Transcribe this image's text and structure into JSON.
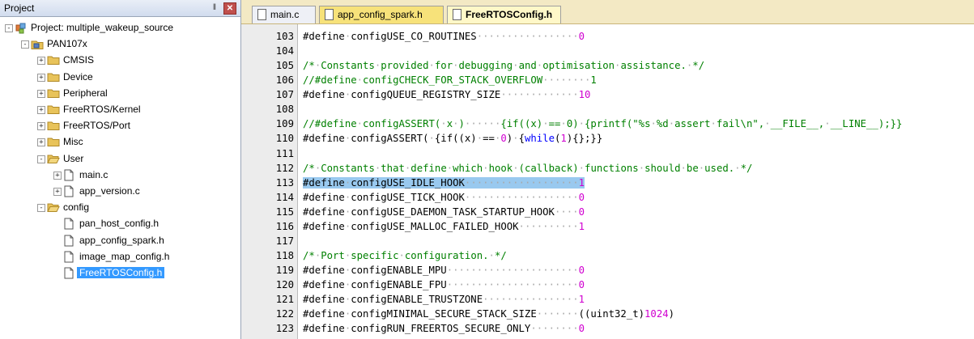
{
  "project_panel": {
    "title": "Project",
    "pin_icon": "pin-icon",
    "close_icon": "close-icon",
    "tree": [
      {
        "label": "Project: multiple_wakeup_source",
        "icon": "project-icon",
        "expander": "-",
        "level": 0
      },
      {
        "label": "PAN107x",
        "icon": "target-icon",
        "expander": "-",
        "level": 1
      },
      {
        "label": "CMSIS",
        "icon": "folder-icon",
        "expander": "+",
        "level": 2
      },
      {
        "label": "Device",
        "icon": "folder-icon",
        "expander": "+",
        "level": 2
      },
      {
        "label": "Peripheral",
        "icon": "folder-icon",
        "expander": "+",
        "level": 2
      },
      {
        "label": "FreeRTOS/Kernel",
        "icon": "folder-icon",
        "expander": "+",
        "level": 2
      },
      {
        "label": "FreeRTOS/Port",
        "icon": "folder-icon",
        "expander": "+",
        "level": 2
      },
      {
        "label": "Misc",
        "icon": "folder-icon",
        "expander": "+",
        "level": 2
      },
      {
        "label": "User",
        "icon": "folder-open-icon",
        "expander": "-",
        "level": 2
      },
      {
        "label": "main.c",
        "icon": "file-icon",
        "expander": "+",
        "level": 3
      },
      {
        "label": "app_version.c",
        "icon": "file-icon",
        "expander": "+",
        "level": 3
      },
      {
        "label": "config",
        "icon": "folder-open-icon",
        "expander": "-",
        "level": 2
      },
      {
        "label": "pan_host_config.h",
        "icon": "file-icon",
        "expander": "",
        "level": 3
      },
      {
        "label": "app_config_spark.h",
        "icon": "file-icon",
        "expander": "",
        "level": 3
      },
      {
        "label": "image_map_config.h",
        "icon": "file-icon",
        "expander": "",
        "level": 3
      },
      {
        "label": "FreeRTOSConfig.h",
        "icon": "file-icon",
        "expander": "",
        "level": 3,
        "selected": true
      }
    ]
  },
  "editor": {
    "tabs": [
      {
        "label": "main.c",
        "active": false
      },
      {
        "label": "app_config_spark.h",
        "active": false
      },
      {
        "label": "FreeRTOSConfig.h",
        "active": true
      }
    ],
    "lines": [
      {
        "n": "103",
        "text": "#define configUSE_CO_ROUTINES                 0"
      },
      {
        "n": "104",
        "text": ""
      },
      {
        "n": "105",
        "text": "/* Constants provided for debugging and optimisation assistance. */"
      },
      {
        "n": "106",
        "text": "//#define configCHECK_FOR_STACK_OVERFLOW        1"
      },
      {
        "n": "107",
        "text": "#define configQUEUE_REGISTRY_SIZE             10"
      },
      {
        "n": "108",
        "text": ""
      },
      {
        "n": "109",
        "text": "//#define configASSERT( x )      {if((x) == 0) {printf(\"%s %d assert fail\\n\", __FILE__, __LINE__);}}"
      },
      {
        "n": "110",
        "text": "#define configASSERT( x )       {if((x) == 0) {while(1){};}}"
      },
      {
        "n": "111",
        "text": ""
      },
      {
        "n": "112",
        "text": "/* Constants that define which hook (callback) functions should be used. */"
      },
      {
        "n": "113",
        "text": "#define configUSE_IDLE_HOOK                   1"
      },
      {
        "n": "114",
        "text": "#define configUSE_TICK_HOOK                   0"
      },
      {
        "n": "115",
        "text": "#define configUSE_DAEMON_TASK_STARTUP_HOOK    0"
      },
      {
        "n": "116",
        "text": "#define configUSE_MALLOC_FAILED_HOOK          1"
      },
      {
        "n": "117",
        "text": ""
      },
      {
        "n": "118",
        "text": "/* Port specific configuration. */"
      },
      {
        "n": "119",
        "text": "#define configENABLE_MPU                      0"
      },
      {
        "n": "120",
        "text": "#define configENABLE_FPU                      0"
      },
      {
        "n": "121",
        "text": "#define configENABLE_TRUSTZONE                1"
      },
      {
        "n": "122",
        "text": "#define configMINIMAL_SECURE_STACK_SIZE       ((uint32_t)1024)"
      },
      {
        "n": "123",
        "text": "#define configRUN_FREERTOS_SECURE_ONLY        0"
      }
    ],
    "highlighted_line": "113",
    "colors": {
      "comment": "#008000",
      "number": "#d000d0",
      "keyword": "#0000ff",
      "selection": "#99c9ef"
    }
  }
}
